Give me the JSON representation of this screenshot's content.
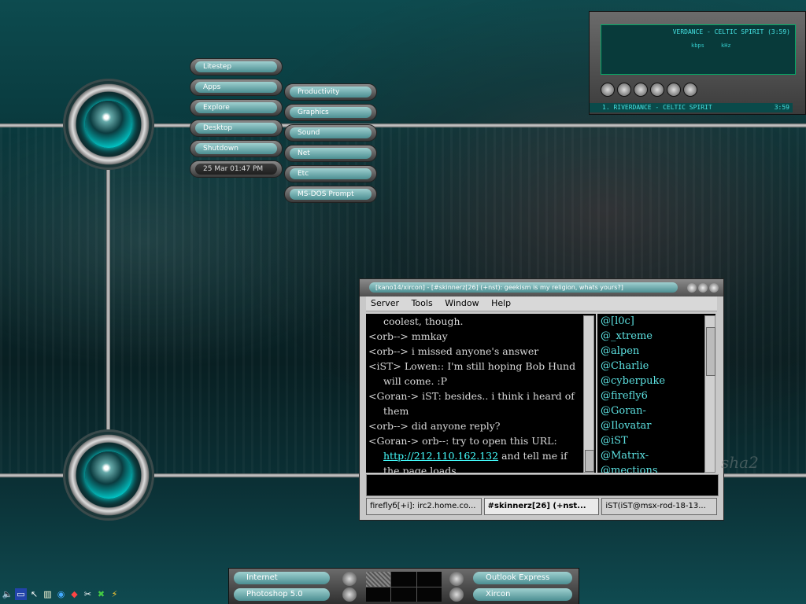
{
  "desktop": {
    "menu": [
      "Litestep",
      "Apps",
      "Explore",
      "Desktop",
      "Shutdown"
    ],
    "clock": "25 Mar 01:47 PM",
    "submenu": [
      "Productivity",
      "Graphics",
      "Sound",
      "Net",
      "Etc",
      "MS-DOS Prompt"
    ],
    "signature": "sha2"
  },
  "winamp": {
    "song_title": "VERDANCE - CELTIC SPIRIT (3:59)",
    "kbps_label": "kbps",
    "khz_label": "kHz",
    "playlist_track": "1. RIVERDANCE - CELTIC SPIRIT",
    "playlist_duration": "3:59"
  },
  "irc": {
    "title": "[kano14/xircon] - [#skinnerz[26] (+nst): geekism is my religion, whats yours?]",
    "menu": [
      "Server",
      "Tools",
      "Window",
      "Help"
    ],
    "chat": [
      {
        "text": "coolest, though.",
        "indent": true
      },
      {
        "text": "<orb--> mmkay",
        "indent": false
      },
      {
        "text": "<orb--> i missed anyone's answer",
        "indent": false
      },
      {
        "text": "<iST> Lowen:: I'm still hoping Bob Hund",
        "indent": false
      },
      {
        "text": "will come. :P",
        "indent": true
      },
      {
        "text": "<Goran-> iST: besides.. i think i heard of",
        "indent": false
      },
      {
        "text": "them",
        "indent": true
      },
      {
        "text": "<orb--> did anyone reply?",
        "indent": false
      },
      {
        "text": "<Goran-> orb--: try to open this URL:",
        "indent": false
      }
    ],
    "url": "http://212.110.162.132",
    "url_suffix": " and tell me if",
    "last_line": "the page loads",
    "users": [
      "@[l0c]",
      "@_xtreme",
      "@alpen",
      "@Charlie",
      "@cyberpuke",
      "@firefly6",
      "@Goran-",
      "@Ilovatar",
      "@iST",
      "@Matrix-",
      "@mections"
    ],
    "tabs": [
      "fireflyб[+i]: irc2.home.co...",
      "#skinnerz[26] (+nst...",
      "iST(iST@msx-rod-18-13..."
    ]
  },
  "taskbar": {
    "left_buttons": [
      "Internet",
      "Photoshop 5.0"
    ],
    "right_buttons": [
      "Outlook Express",
      "Xircon"
    ]
  },
  "tray": {
    "icons": [
      "speaker-icon",
      "monitor-icon",
      "cursor-icon",
      "folder-icon",
      "globe-icon",
      "apps-icon",
      "tools-icon",
      "excel-icon",
      "flash-icon"
    ]
  }
}
